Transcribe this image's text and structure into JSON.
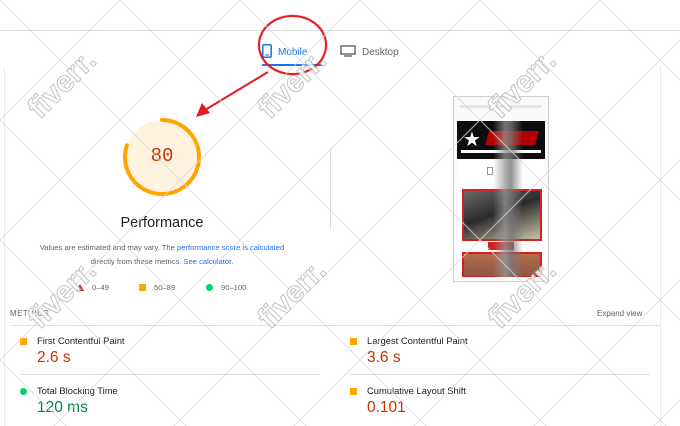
{
  "tabs": {
    "mobile_label": "Mobile",
    "desktop_label": "Desktop"
  },
  "score": {
    "value": "80",
    "fraction": 0.8,
    "title": "Performance",
    "desc_part1": "Values are estimated and may vary. The ",
    "desc_link1": "performance score is calculated",
    "desc_part2": " directly from these metrics. ",
    "desc_link2": "See calculator."
  },
  "legend": {
    "fail": "0–49",
    "average": "50–89",
    "pass": "90–100"
  },
  "metrics": {
    "heading": "METRICS",
    "expand_label": "Expand view",
    "items": [
      {
        "title": "First Contentful Paint",
        "value": "2.6 s",
        "status": "average"
      },
      {
        "title": "Largest Contentful Paint",
        "value": "3.6 s",
        "status": "average"
      },
      {
        "title": "Total Blocking Time",
        "value": "120 ms",
        "status": "pass"
      },
      {
        "title": "Cumulative Layout Shift",
        "value": "0.101",
        "status": "average"
      }
    ]
  },
  "colors": {
    "accent": "#1a73e8",
    "average": "#ffa400",
    "average_text": "#c33300",
    "pass": "#0cce6b",
    "pass_text": "#018642",
    "fail": "#e31b23"
  },
  "watermark_text": "fiverr."
}
